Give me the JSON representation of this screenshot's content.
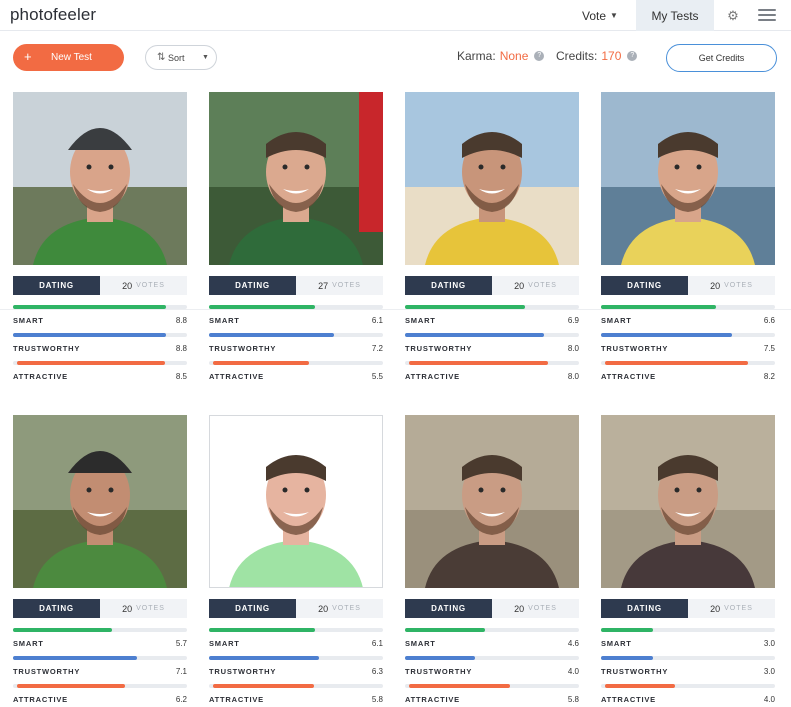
{
  "nav": {
    "logo": "photofeeler",
    "vote_label": "Vote",
    "mytests_label": "My Tests",
    "gear_icon": "gear-icon",
    "menu_icon": "hamburger-menu-icon"
  },
  "toolbar": {
    "new_test_label": "New Test",
    "sort_label": "Sort",
    "karma_label": "Karma:",
    "karma_value": "None",
    "credits_label": "Credits:",
    "credits_value": "170",
    "get_credits_label": "Get Credits"
  },
  "metric_labels": {
    "smart": "SMART",
    "trustworthy": "TRUSTWORTHY",
    "attractive": "ATTRACTIVE"
  },
  "votes_word": "VOTES",
  "colors": {
    "accent": "#f26b43",
    "smart": "#2fb465",
    "trustworthy": "#4d7fd0",
    "attractive": "#f26b43",
    "category_bg": "#2e3a4f"
  },
  "cards": [
    {
      "category": "DATING",
      "votes": "20",
      "smart": "8.8",
      "trustworthy": "8.8",
      "attractive": "8.5",
      "photo": "man-beanie-mountains"
    },
    {
      "category": "DATING",
      "votes": "27",
      "smart": "6.1",
      "trustworthy": "7.2",
      "attractive": "5.5",
      "photo": "man-green-shirt-red-phonebox"
    },
    {
      "category": "DATING",
      "votes": "20",
      "smart": "6.9",
      "trustworthy": "8.0",
      "attractive": "8.0",
      "photo": "man-yellow-shirt-beach"
    },
    {
      "category": "DATING",
      "votes": "20",
      "smart": "6.6",
      "trustworthy": "7.5",
      "attractive": "8.2",
      "photo": "man-yellow-shirt-harbor"
    },
    {
      "category": "DATING",
      "votes": "20",
      "smart": "5.7",
      "trustworthy": "7.1",
      "attractive": "6.2",
      "photo": "man-green-jacket-fjord"
    },
    {
      "category": "DATING",
      "votes": "20",
      "smart": "6.1",
      "trustworthy": "6.3",
      "attractive": "5.8",
      "photo": "man-white-background"
    },
    {
      "category": "DATING",
      "votes": "20",
      "smart": "4.6",
      "trustworthy": "4.0",
      "attractive": "5.8",
      "photo": "man-plaid-shirt-indoor"
    },
    {
      "category": "DATING",
      "votes": "20",
      "smart": "3.0",
      "trustworthy": "3.0",
      "attractive": "4.0",
      "photo": "man-plaid-shirt-indoor-side-glance"
    }
  ]
}
